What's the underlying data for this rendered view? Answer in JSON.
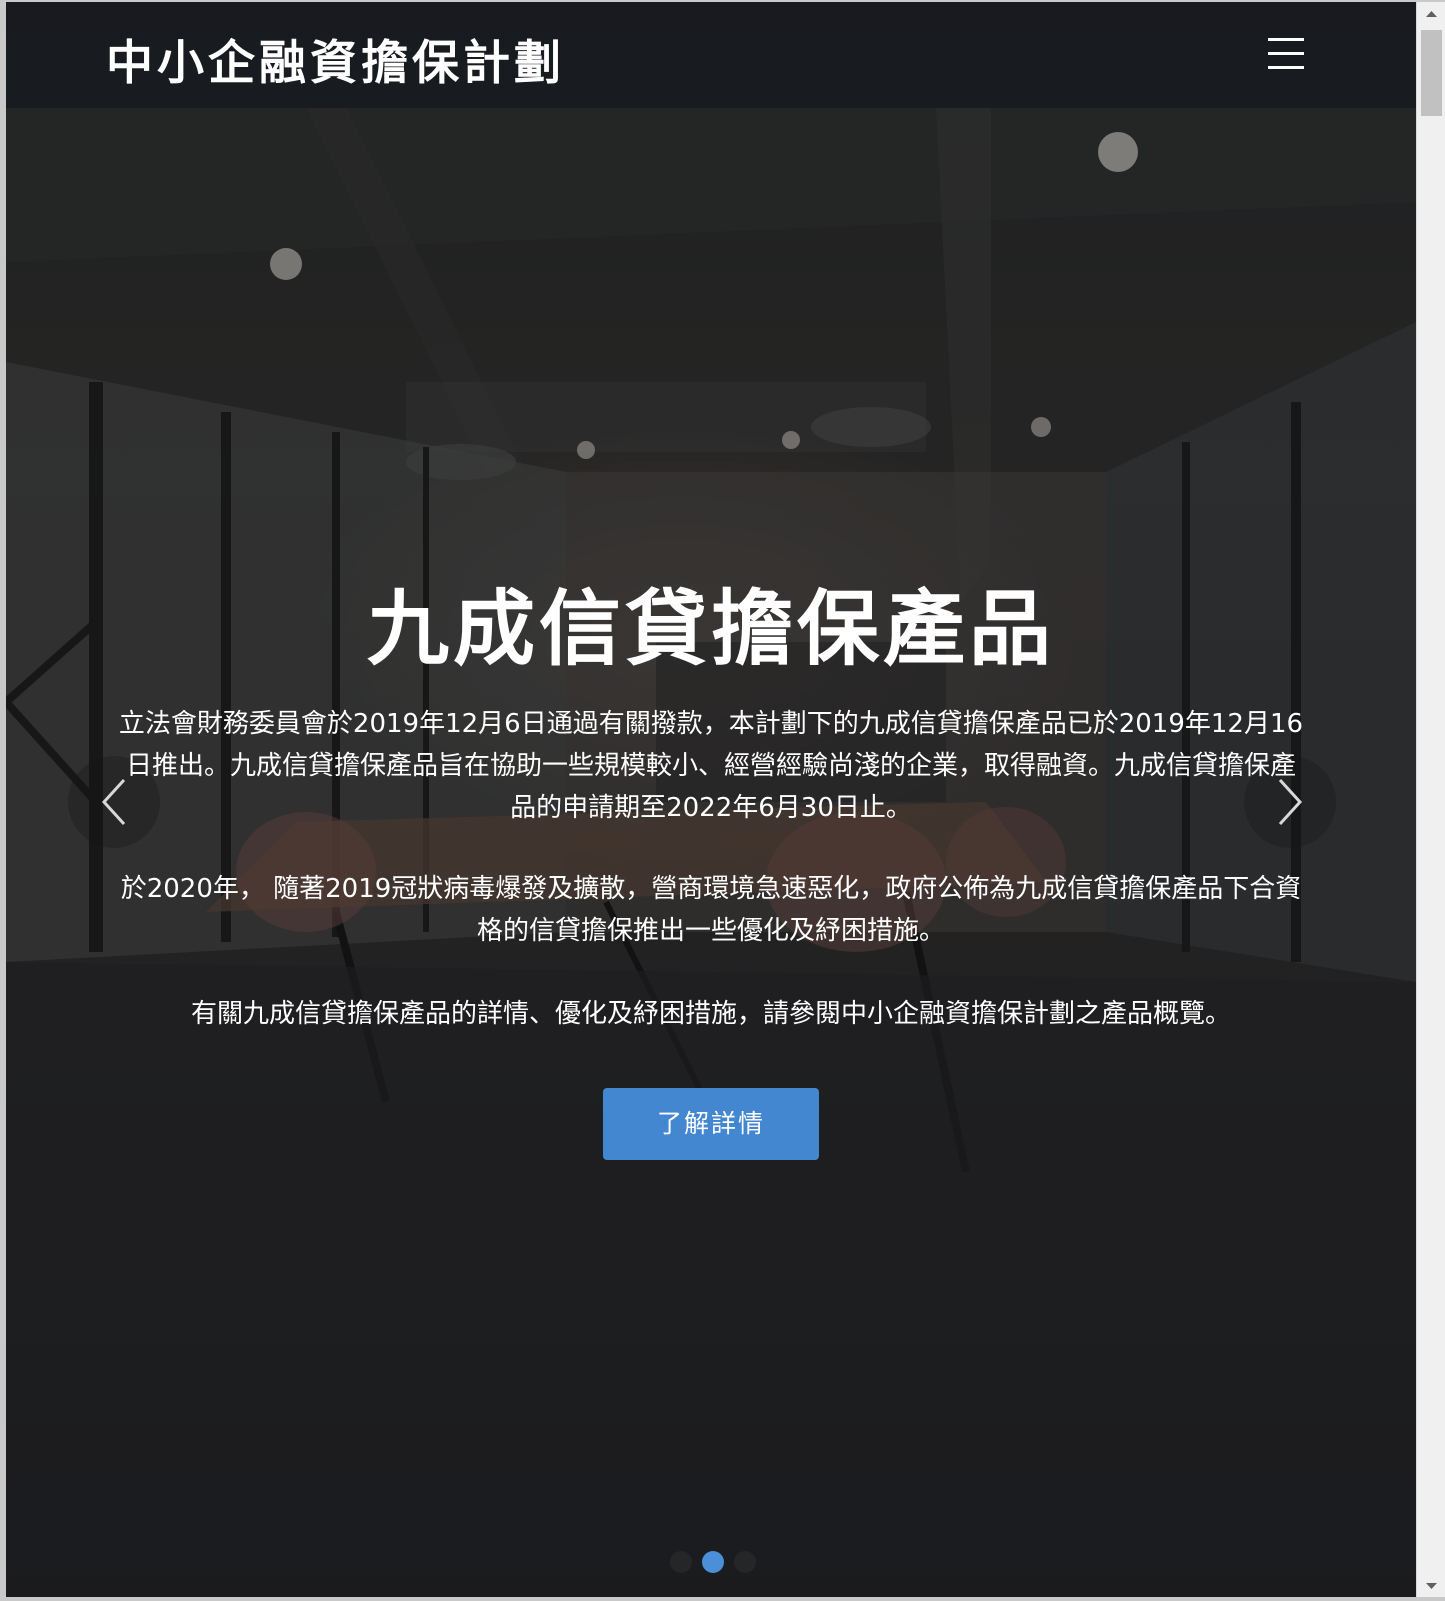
{
  "navbar": {
    "brand": "中小企融資擔保計劃",
    "menu_icon": "hamburger-menu-icon"
  },
  "hero": {
    "title": "九成信貸擔保產品",
    "paragraphs": [
      "立法會財務委員會於2019年12月6日通過有關撥款，本計劃下的九成信貸擔保產品已於2019年12月16日推出。九成信貸擔保產品旨在協助一些規模較小、經營經驗尚淺的企業，取得融資。九成信貸擔保產品的申請期至2022年6月30日止。",
      "於2020年， 隨著2019冠狀病毒爆發及擴散，營商環境急速惡化，政府公佈為九成信貸擔保產品下合資格的信貸擔保推出一些優化及紓困措施。",
      "有關九成信貸擔保產品的詳情、優化及紓困措施，請參閱中小企融資擔保計劃之產品概覽。"
    ],
    "cta_label": "了解詳情"
  },
  "carousel": {
    "prev_icon": "chevron-left-icon",
    "next_icon": "chevron-right-icon",
    "indicator_count": 3,
    "active_index": 1
  },
  "colors": {
    "accent": "#4387d1",
    "navbar_bg": "#181b1f",
    "text": "#ffffff"
  }
}
